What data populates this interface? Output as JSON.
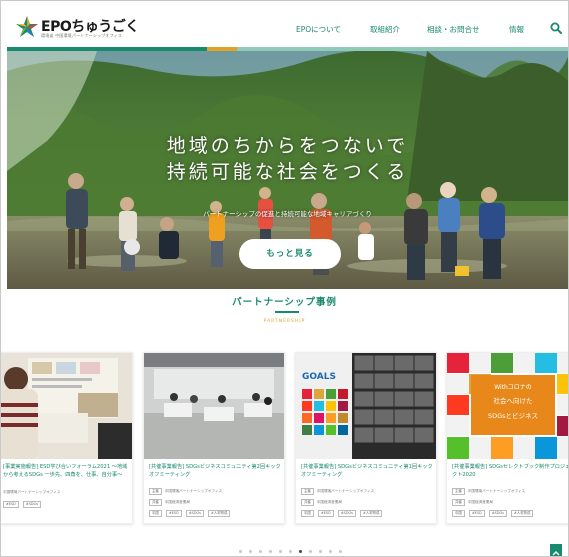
{
  "header": {
    "logo_text": "EPOちゅうごく",
    "logo_sub": "環境省 中国環境パートナーシップオフィス",
    "nav": [
      {
        "label": "EPOについて"
      },
      {
        "label": "取組紹介"
      },
      {
        "label": "相談・お問合せ"
      },
      {
        "label": "情報"
      }
    ]
  },
  "hero": {
    "title_line1": "地域のちからをつないで",
    "title_line2": "持続可能な社会をつくる",
    "subtitle": "パートナーシップの促進と持続可能な地域キャリアづくり",
    "more_button": "もっと見る"
  },
  "partnership": {
    "title": "パートナーシップ事例",
    "subtitle_en": "PARTNERSHIP",
    "cards": [
      {
        "title": "[事業実施報告] ESD学び合いフォーラム2021 ～地域から考えるSDGs 一歩先、四角を、仕事、自分事～",
        "org": "中国環境パートナーシップオフィス",
        "tags_row1": [
          "#ESD",
          "#SDGs"
        ],
        "tags_row2": []
      },
      {
        "title": "[共催事業報告] SDGsビジネスコミュニティ第2回キックオフミーティング",
        "org": "中国環境パートナーシップオフィス",
        "org2": "中国経済産業局",
        "tags_row1": [
          "中国",
          "#ESD",
          "#SDGs",
          "#人材育成"
        ]
      },
      {
        "title": "[共催事業報告] SDGsビジネスコミュニティ第1回キックオフミーティング",
        "org": "中国環境パートナーシップオフィス",
        "org2": "中国経済産業局",
        "tags_row1": [
          "中国",
          "#ESD",
          "#SDGs",
          "#人材育成"
        ]
      },
      {
        "title": "[共催事業報告] SDGsセレクトブック制作プロジェクト2020",
        "org": "中国環境パートナーシップオフィス",
        "org2": "中国経済産業局",
        "tags_row1": [
          "中国",
          "#ESD",
          "#SDGs",
          "#人材育成"
        ]
      }
    ],
    "thumb_text": {
      "card3_goals": "GOALS",
      "card4_line1": "Withコロナの",
      "card4_line2": "社会へ向けた",
      "card4_line3": "SDGsとビジネス"
    }
  },
  "colors": {
    "brand_green": "#1a8a6e",
    "accent_orange": "#e0a32a",
    "header_bar": [
      "#1a8a6e",
      "#e0a32a",
      "#1a8a6e"
    ]
  },
  "icons": {
    "logo": "epo-star-logo-icon",
    "search": "search-icon",
    "page_top": "arrow-up-icon"
  },
  "carousel": {
    "total_dots": 11,
    "active_dot": 7
  }
}
